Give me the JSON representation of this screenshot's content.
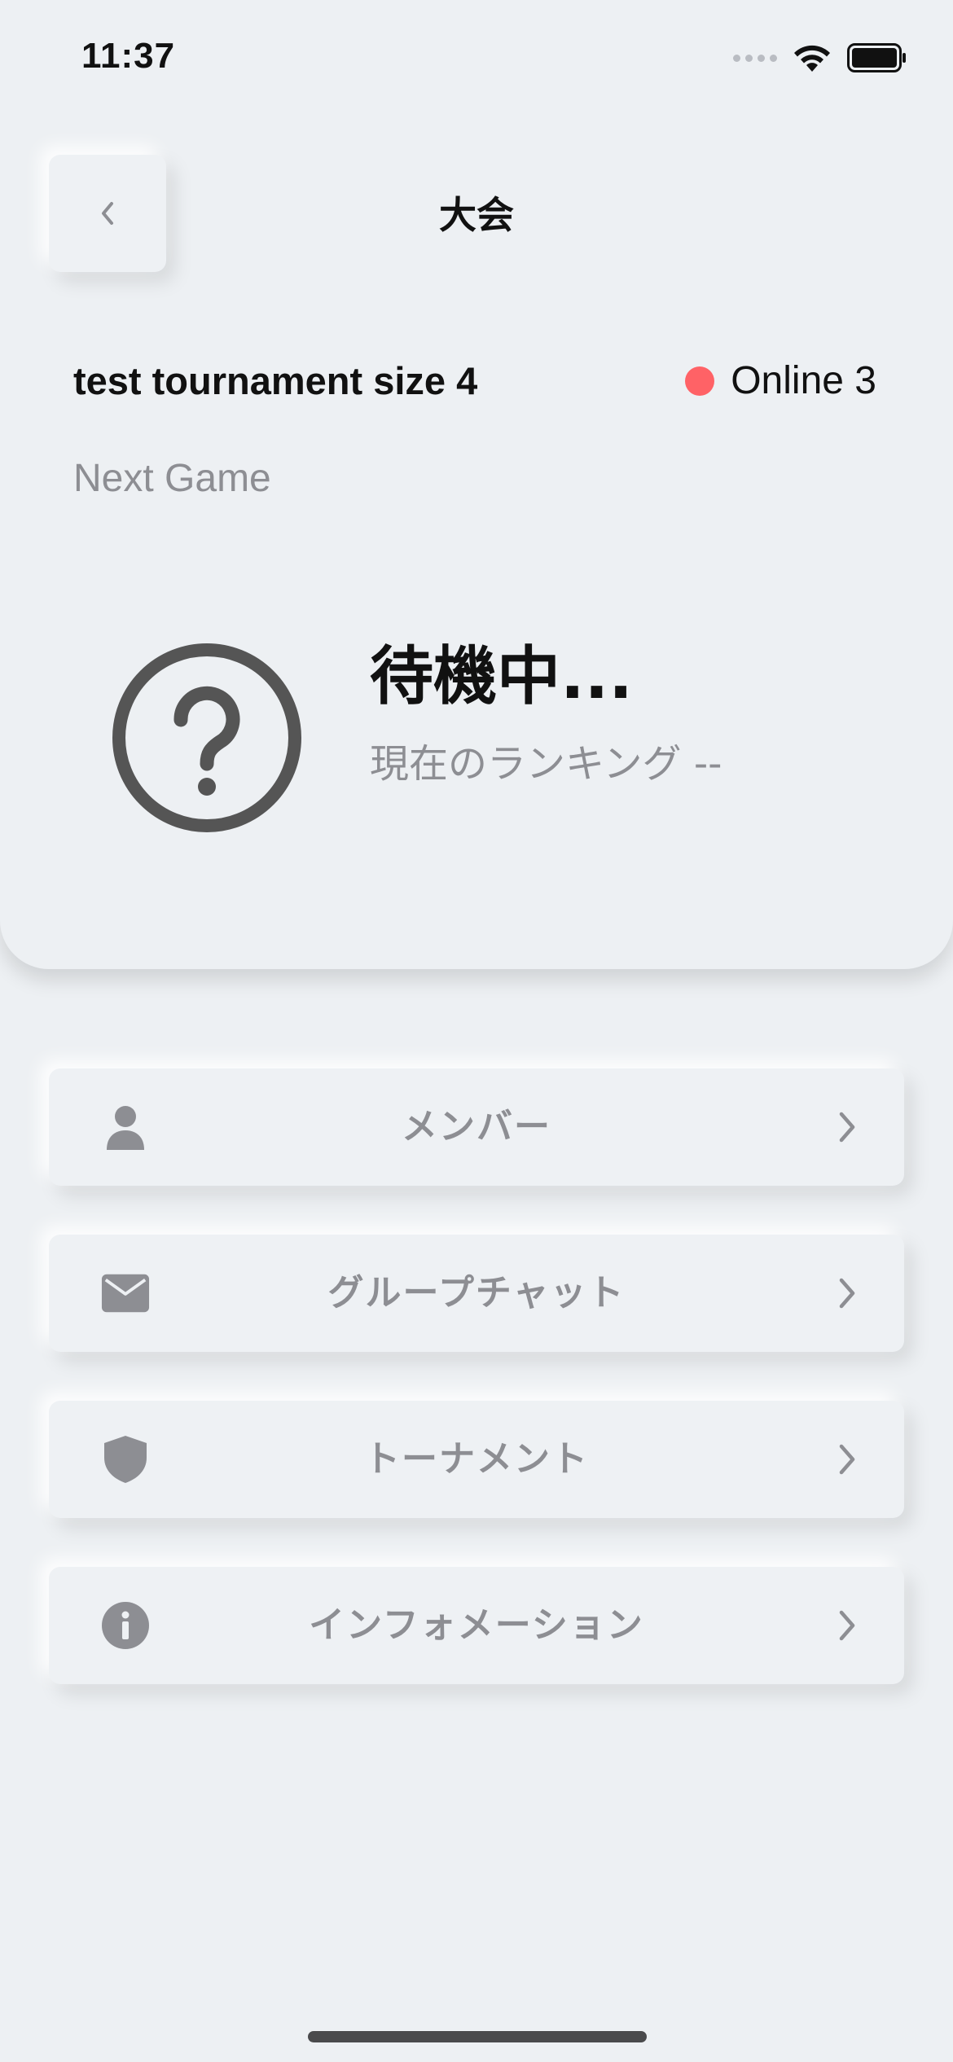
{
  "status_bar": {
    "time": "11:37"
  },
  "header": {
    "title": "大会"
  },
  "tournament": {
    "name": "test tournament size 4",
    "online_label": "Online 3",
    "online_color": "#ff6266"
  },
  "next_game": {
    "label": "Next Game",
    "status": "待機中...",
    "ranking": "現在のランキング --"
  },
  "menu": {
    "items": [
      {
        "label": "メンバー",
        "icon": "person-icon"
      },
      {
        "label": "グループチャット",
        "icon": "mail-icon"
      },
      {
        "label": "トーナメント",
        "icon": "shield-icon"
      },
      {
        "label": "インフォメーション",
        "icon": "info-icon"
      }
    ]
  },
  "colors": {
    "background": "#edf0f3",
    "muted_text": "#8d8e93",
    "icon_gray": "#8d8e93",
    "question_icon": "#555555"
  }
}
